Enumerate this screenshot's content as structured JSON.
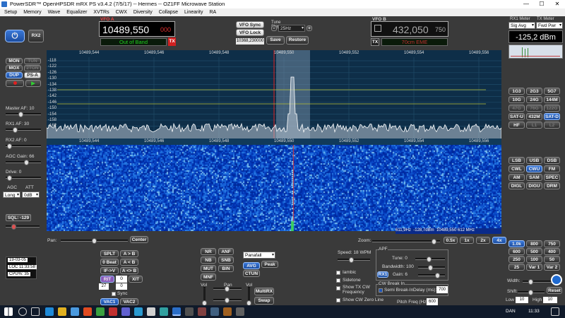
{
  "window": {
    "title": "PowerSDR™ OpenHPSDR mRX PS v3.4.2 (7/5/17)   --   Hermes  --  OZ1FF Microwave Station",
    "min": "—",
    "max": "☐",
    "close": "✕"
  },
  "menu": [
    "Setup",
    "Memory",
    "Wave",
    "Equalizer",
    "XVTRs",
    "CWX",
    "Diversity",
    "Collapse",
    "Linearity",
    "RA"
  ],
  "power": {
    "rx2": "RX2"
  },
  "vfoa": {
    "freq": "10489,550",
    "sub": "000",
    "status": "Out of Band",
    "tx": "TX",
    "label": "VFO A"
  },
  "vfo_controls": {
    "sync": "VFO Sync",
    "lock": "VFO Lock",
    "tune_label": "Tune\nStep:",
    "tune_step": "25Hz",
    "memfreq": "10368,230000",
    "save": "Save",
    "restore": "Restore"
  },
  "vfob": {
    "label": "VFO B",
    "freq": "432,050",
    "sub": "750",
    "tx": "TX",
    "band": "70cm EME"
  },
  "meter": {
    "rx1_label": "RX1 Meter",
    "tx_label": "TX Meter",
    "rx_mode": "Sig Avg",
    "tx_mode": "Fwd Pwr",
    "value": "-125,2 dBm"
  },
  "left_buttons": [
    "MON",
    "TUN",
    "MOX",
    "2TON",
    "DUP",
    "PS-A"
  ],
  "left_labels": {
    "master_af": "Master AF:",
    "master_af_val": "10",
    "rx1_af": "RX1 AF:",
    "rx1_af_val": "30",
    "rx2_af": "RX2 AF:",
    "rx2_af_val": "0",
    "agc_gain": "AGC Gain:",
    "agc_gain_val": "66",
    "drive": "Drive:",
    "drive_val": "0",
    "agc": "AGC",
    "att": "ATT",
    "agc_sel": "Long",
    "att_sel": "0dB",
    "sql": "SQL:",
    "sql_val": "-129"
  },
  "pan_scale_top": [
    "10489,544",
    "10489,546",
    "10489,548",
    "10489,550",
    "10489,552",
    "10489,554",
    "10489,556"
  ],
  "pan_scale_mid": [
    "10489,544",
    "10489,546",
    "10489,548",
    "10489,550",
    "10489,552",
    "10489,554",
    "10489,556"
  ],
  "db_scale": [
    "-118",
    "-122",
    "-126",
    "-130",
    "-134",
    "-138",
    "-142",
    "-146",
    "-150",
    "-154",
    "-158",
    "-162"
  ],
  "water_readout": {
    "offset": "611,9Hz",
    "level": "-128,7dBm",
    "freq": "10489,550 612 MHz"
  },
  "band_buttons": [
    "1G3",
    "2G3",
    "5G7",
    "10G",
    "24G",
    "144M",
    "47G",
    "76G",
    "122G",
    "SAT-U",
    "432M",
    "SAT-D",
    "HF",
    "L1",
    "L2"
  ],
  "mode_buttons": [
    "LSB",
    "USB",
    "DSB",
    "CWL",
    "CWU",
    "FM",
    "AM",
    "SAM",
    "SPEC",
    "DIGL",
    "DIGU",
    "DRM"
  ],
  "filter_buttons": [
    "1.0k",
    "800",
    "750",
    "600",
    "500",
    "400",
    "250",
    "100",
    "50",
    "25",
    "Var 1",
    "Var 2"
  ],
  "status": {
    "date": "19-03-05",
    "loc": "LOC 11:33:58",
    "cpu": "CPU%: 35"
  },
  "pan_label": "Pan:",
  "center": "Center",
  "vfo_ops": {
    "splt": "SPLT",
    "atob": "A > B",
    "beat": "0 Beat",
    "btoa": "A < B",
    "ifv": "IF->V",
    "swap": "A <> B",
    "rit": "RIT",
    "rit_val": "0",
    "xit": "XIT",
    "xit_val": "0",
    "step": "27",
    "step_val": "0",
    "sync": "Sync",
    "vac1": "VAC1",
    "vac2": "VAC2"
  },
  "dsp": {
    "nr": "NR",
    "anf": "ANF",
    "nb": "NB",
    "snb": "SNB",
    "mut": "MUT",
    "bin": "BIN",
    "mnf": "MNF"
  },
  "display": {
    "mode": "Panafall",
    "avg": "AVG",
    "peak": "Peak",
    "ctun": "CTUN",
    "vol": "Vol",
    "pan": "Pan",
    "vol2": "Vol",
    "multirx": "MultiRX",
    "swap": "Swap"
  },
  "zoom": {
    "label": "Zoom:",
    "buttons": [
      "0.5x",
      "1x",
      "2x",
      "4x"
    ]
  },
  "cw": {
    "speed": "Speed: 18 WPM",
    "iambic": "Iambic",
    "sidetone": "Sidetone",
    "show_tx": "Show TX CW Frequency",
    "show_zero": "Show CW Zero Line",
    "apf": "APF",
    "tune": "Tune:",
    "tune_val": "0",
    "bw": "Bandwidth:",
    "bw_val": "100",
    "rx1": "RX1",
    "gain": "Gain:",
    "gain_val": "6",
    "breakin": "CW Break In",
    "semi": "Semi Break-In",
    "delay": "Delay (ms):",
    "delay_val": "700",
    "pitch": "Pitch Freq (Hz):",
    "pitch_val": "600"
  },
  "filter_bottom": {
    "width": "Width:",
    "shift": "Shift:",
    "reset": "Reset",
    "low": "Low",
    "low_val": "10",
    "high": "High",
    "high_val": "10"
  },
  "taskbar": {
    "lang": "DAN",
    "time": "11:33"
  },
  "colors": {
    "accent": "#1f56b8",
    "red": "#e02020",
    "green": "#30d030"
  }
}
